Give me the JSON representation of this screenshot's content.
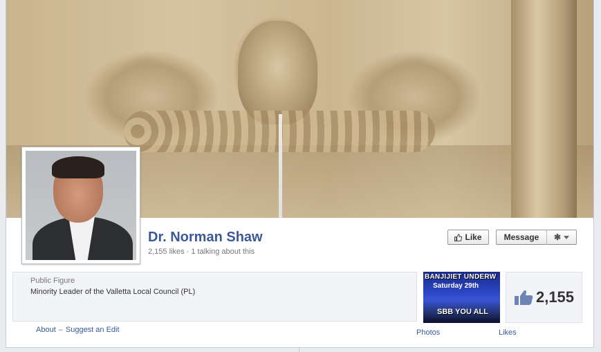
{
  "profile": {
    "name": "Dr. Norman Shaw",
    "stats": "2,155 likes · 1 talking about this",
    "category": "Public Figure",
    "description": "Minority Leader of the Valletta Local Council (PL)"
  },
  "actions": {
    "like_label": "Like",
    "message_label": "Message",
    "gear_icon": "gear-icon",
    "like_icon": "thumbs-up-icon"
  },
  "links": {
    "about": "About",
    "separator": "–",
    "suggest_edit": "Suggest an Edit"
  },
  "apps": {
    "photos_label": "Photos",
    "photos_thumb_text": [
      "BANJIJIET UNDERW",
      "Saturday 29th",
      "SBB YOU ALL"
    ],
    "likes_count": "2,155",
    "likes_label": "Likes"
  },
  "colors": {
    "link": "#3b5998",
    "accent": "#3b5998"
  }
}
